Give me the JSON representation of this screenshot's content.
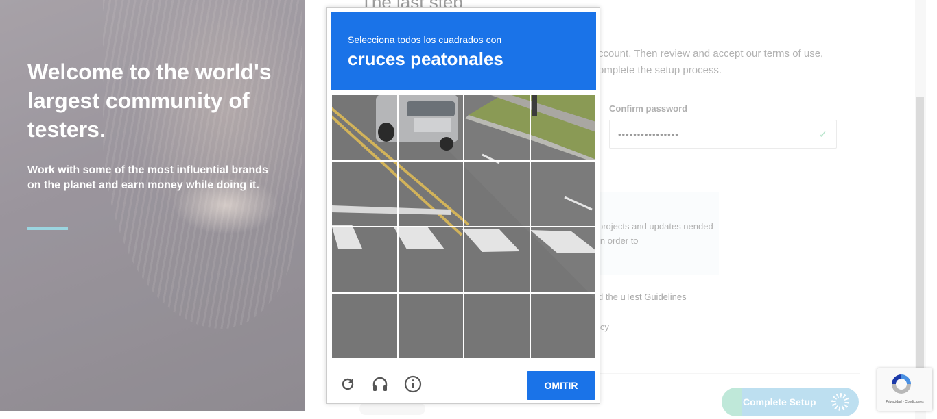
{
  "hero": {
    "title": "Welcome to the world's largest community of testers.",
    "subtitle": "Work with some of the most influential brands on the planet and earn money while doing it."
  },
  "form": {
    "title": "The last step",
    "intro": "ccount. Then review and accept our terms of use, omplete the setup process.",
    "confirm_password_label": "Confirm password",
    "confirm_password_value": "••••••••••••••••",
    "info_text": "projects and updates nended in order to",
    "guidelines_prefix": "d the ",
    "guidelines_link": "uTest Guidelines",
    "policy_fragment": "icy",
    "complete_button": "Complete Setup"
  },
  "captcha": {
    "instruction": "Selecciona todos los cuadrados con",
    "target": "cruces peatonales",
    "skip_button": "OMITIR",
    "grid_rows": 4,
    "grid_cols": 4
  },
  "recaptcha_badge": {
    "text": "Privacidad - Condiciones"
  },
  "colors": {
    "captcha_blue": "#1a73e8",
    "hero_rule": "#7fc9d8",
    "button_gradient_start": "#92d8be",
    "button_gradient_end": "#8dc8e6"
  },
  "icons": {
    "reload": "reload-icon",
    "audio": "headphones-icon",
    "info": "info-icon",
    "check": "check-icon"
  }
}
